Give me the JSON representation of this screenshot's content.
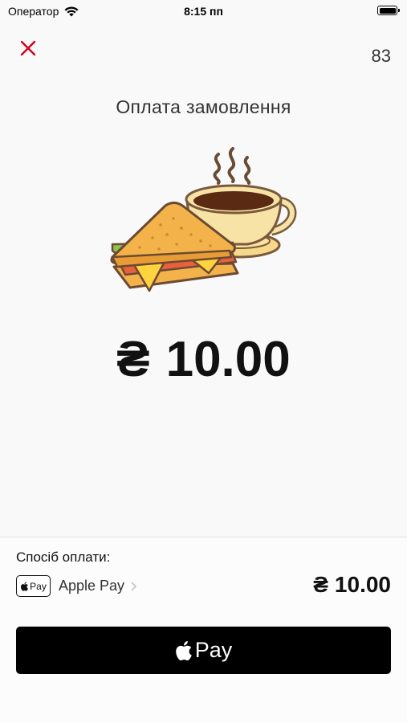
{
  "status_bar": {
    "carrier": "Оператор",
    "time": "8:15 пп",
    "icons": [
      "wifi-icon",
      "battery-icon"
    ]
  },
  "header": {
    "close_icon": "close-icon",
    "counter": "83"
  },
  "main": {
    "title": "Оплата замовлення",
    "illustration_icon": "sandwich-coffee-icon",
    "currency_symbol": "₴",
    "amount": "10.00"
  },
  "payment": {
    "method_label": "Спосіб оплати:",
    "badge_text": "Pay",
    "method_name": "Apple Pay",
    "currency_symbol": "₴",
    "amount": "10.00",
    "button_label": "Pay"
  },
  "colors": {
    "close": "#d0021b",
    "background": "#f9f9f9",
    "button": "#000000"
  }
}
